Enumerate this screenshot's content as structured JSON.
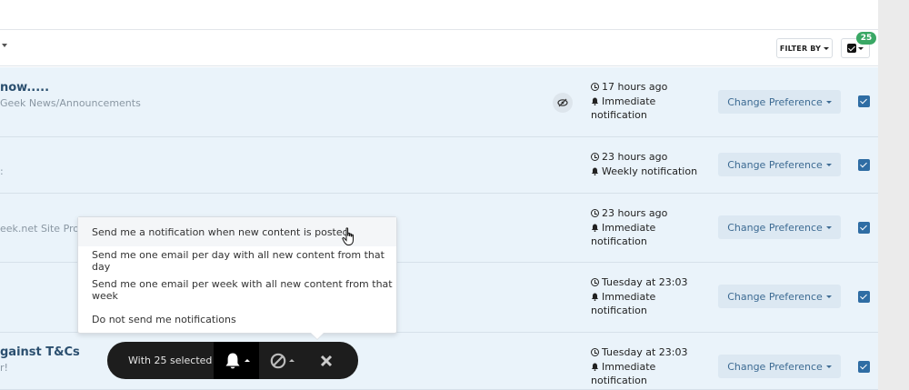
{
  "filter_bar": {
    "filter_label": "FILTER BY",
    "selected_count": "25"
  },
  "rows": [
    {
      "title": "now.....",
      "subtitle": "Geek News/Announcements",
      "time": "17 hours ago",
      "pref_line1": "Immediate",
      "pref_line2": "notification",
      "button": "Change Preference"
    },
    {
      "title": "",
      "subtitle": ":",
      "time": "23 hours ago",
      "pref_line1": "Weekly notification",
      "pref_line2": "",
      "button": "Change Preference"
    },
    {
      "title": "",
      "subtitle": "eek.net Site Prob",
      "time": "23 hours ago",
      "pref_line1": "Immediate",
      "pref_line2": "notification",
      "button": "Change Preference"
    },
    {
      "title": "",
      "subtitle": "",
      "time": "Tuesday at 23:03",
      "pref_line1": "Immediate",
      "pref_line2": "notification",
      "button": "Change Preference"
    },
    {
      "title": "gainst T&Cs",
      "subtitle": "r!",
      "time": "Tuesday at 23:03",
      "pref_line1": "Immediate",
      "pref_line2": "notification",
      "button": "Change Preference"
    }
  ],
  "dropdown": {
    "options": [
      "Send me a notification when new content is posted",
      "Send me one email per day with all new content from that day",
      "Send me one email per week with all new content from that week",
      "Do not send me notifications"
    ]
  },
  "toolbar": {
    "selected_text": "With 25 selected"
  },
  "icons": {
    "bell": "bell-icon",
    "block": "block-icon",
    "close": "close-icon",
    "clock": "clock-icon",
    "eye_slash": "eye-slash-icon",
    "checkbox": "checkbox-icon",
    "cursor": "hand-pointer-icon"
  },
  "colors": {
    "row_bg": "#eaf3fa",
    "button_bg": "#dce8f2",
    "button_text": "#3d6b93",
    "checkbox": "#2f6da4",
    "badge": "#3aa865",
    "toolbar_bg": "#1d1d1d"
  }
}
